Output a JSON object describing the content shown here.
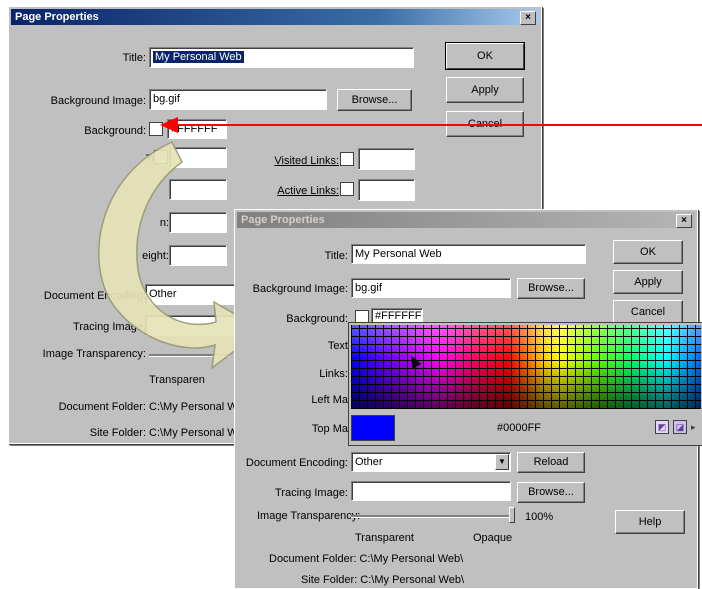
{
  "back_dialog": {
    "title": "Page Properties",
    "close": "×",
    "labels": {
      "title": "Title:",
      "background_image": "Background Image:",
      "background": "Background:",
      "text": "Tex",
      "visited_links": "Visited Links:",
      "active_links": "Active Links:",
      "left_margin": "n:",
      "margin_height": "eight:",
      "document_encoding": "Document Encoding:",
      "tracing_image": "Tracing Image:",
      "image_transparency": "Image Transparency:",
      "transparent": "Transparen",
      "document_folder": "Document Folder:",
      "site_folder": "Site Folder:"
    },
    "values": {
      "title": "My Personal Web",
      "background_image": "bg.gif",
      "background_color": "#FFFFFF",
      "document_encoding": "Other",
      "document_folder": "C:\\My Personal W",
      "site_folder": "C:\\My Personal W"
    },
    "buttons": {
      "ok": "OK",
      "apply": "Apply",
      "cancel": "Cancel",
      "browse": "Browse..."
    }
  },
  "front_dialog": {
    "title": "Page Properties",
    "close": "×",
    "labels": {
      "title": "Title:",
      "background_image": "Background Image:",
      "background": "Background:",
      "text": "Text",
      "links": "Links:",
      "left_margin": "Left Ma",
      "top_margin": "Top Ma",
      "document_encoding": "Document Encoding:",
      "tracing_image": "Tracing Image:",
      "image_transparency": "Image Transparency:",
      "transparent": "Transparent",
      "opaque": "Opaque",
      "percent": "100%",
      "document_folder": "Document Folder: C:\\My Personal Web\\",
      "site_folder": "Site Folder: C:\\My Personal Web\\"
    },
    "values": {
      "title": "My Personal Web",
      "background_image": "bg.gif",
      "background_color": "#FFFFFF",
      "document_encoding": "Other"
    },
    "buttons": {
      "ok": "OK",
      "apply": "Apply",
      "cancel": "Cancel",
      "browse": "Browse...",
      "reload": "Reload",
      "help": "Help"
    }
  },
  "color_picker": {
    "hex_value": "#0000FF",
    "preview_color": "#0000ff"
  },
  "colors": {
    "arrow_red": "#ff0000",
    "curved_arrow": "#e6e3b8"
  }
}
